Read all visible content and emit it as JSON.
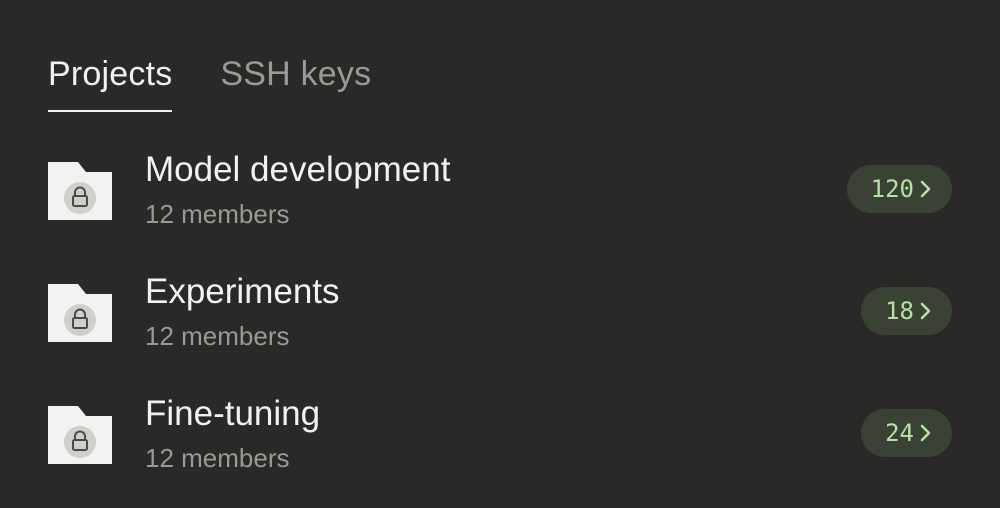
{
  "tabs": [
    {
      "label": "Projects",
      "active": true
    },
    {
      "label": "SSH keys",
      "active": false
    }
  ],
  "projects": [
    {
      "title": "Model development",
      "members": "12 members",
      "count": "120",
      "icon": "locked-folder-icon"
    },
    {
      "title": "Experiments",
      "members": "12 members",
      "count": "18",
      "icon": "locked-folder-icon"
    },
    {
      "title": "Fine-tuning",
      "members": "12 members",
      "count": "24",
      "icon": "locked-folder-icon"
    }
  ],
  "colors": {
    "background": "#2a2927",
    "text_primary": "#f2f2f0",
    "text_secondary": "#9a9996",
    "badge_bg": "#3a4236",
    "badge_text": "#b5e3a2",
    "folder": "#f2f2f0",
    "lock_circle": "#d0cfcc"
  }
}
